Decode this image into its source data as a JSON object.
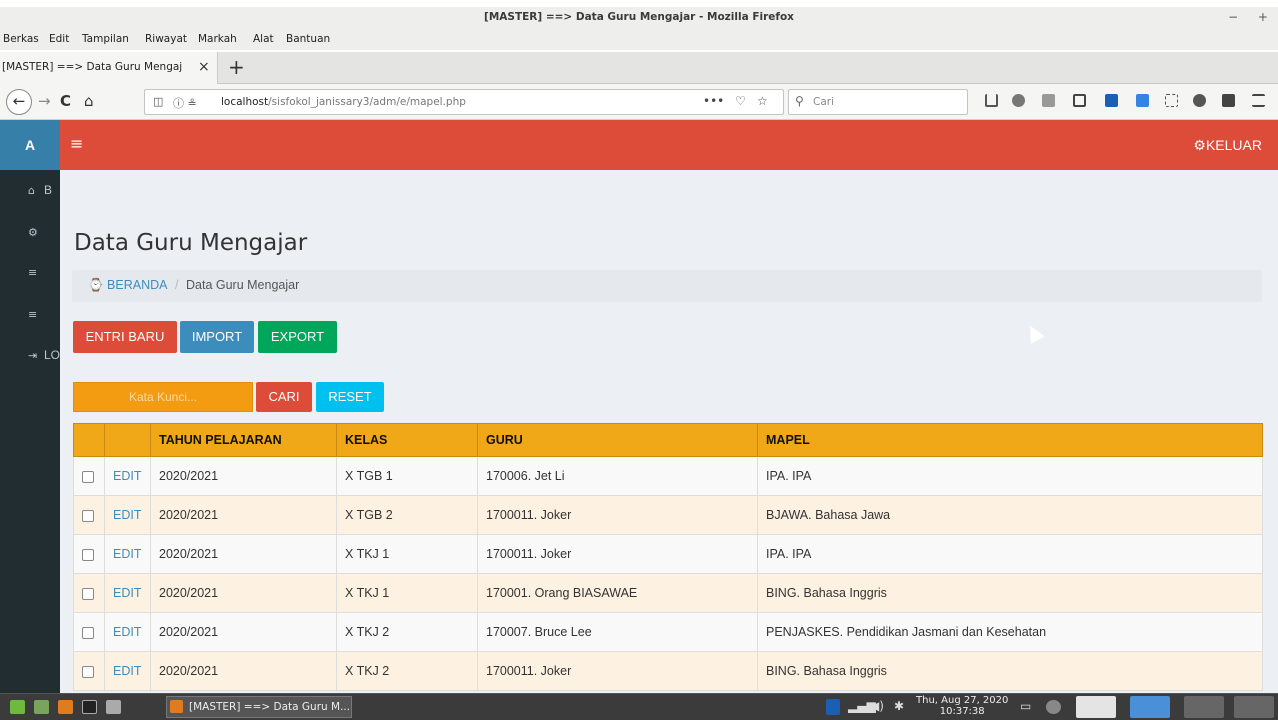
{
  "window": {
    "title": "[MASTER] ==> Data Guru Mengajar - Mozilla Firefox",
    "controls": "− +"
  },
  "menu": [
    "Berkas",
    "Edit",
    "Tampilan",
    "Riwayat",
    "Markah",
    "Alat",
    "Bantuan"
  ],
  "tab": {
    "label": "[MASTER] ==> Data Guru Mengaj",
    "close": "×",
    "new": "+"
  },
  "nav": {
    "url_host": "localhost",
    "url_path": "/sisfokol_janissary3/adm/e/mapel.php",
    "search_placeholder": "Cari",
    "more": "•••"
  },
  "app": {
    "logo": "A",
    "menu_toggle": "≡",
    "logout": "KELUAR",
    "sidebar": [
      {
        "icon": "home-icon",
        "label": "B"
      },
      {
        "icon": "gears-icon",
        "label": ""
      },
      {
        "icon": "database-icon",
        "label": ""
      },
      {
        "icon": "database-icon",
        "label": ""
      },
      {
        "icon": "signout-icon",
        "label": "LO"
      }
    ],
    "page_title": "Data Guru Mengajar",
    "breadcrumb": {
      "home": "BERANDA",
      "sep": "/",
      "current": "Data Guru Mengajar"
    },
    "buttons": {
      "entri": "ENTRI BARU",
      "import": "IMPORT",
      "export": "EXPORT",
      "search": "CARI",
      "reset": "RESET"
    },
    "search_placeholder": "Kata Kunci...",
    "colors": {
      "header": "#dd4b39",
      "sidebar": "#222d32",
      "table_head": "#f0a818",
      "danger": "#dd4b39",
      "primary": "#3c8dbc",
      "success": "#00a65a",
      "info": "#00c0ef",
      "warning": "#f39c12"
    },
    "table": {
      "headers": [
        "",
        "",
        "TAHUN PELAJARAN",
        "KELAS",
        "GURU",
        "MAPEL"
      ],
      "rows": [
        {
          "edit": "EDIT",
          "tahun": "2020/2021",
          "kelas": "X TGB 1",
          "guru": "170006. Jet Li",
          "mapel": "IPA. IPA"
        },
        {
          "edit": "EDIT",
          "tahun": "2020/2021",
          "kelas": "X TGB 2",
          "guru": "1700011. Joker",
          "mapel": "BJAWA. Bahasa Jawa"
        },
        {
          "edit": "EDIT",
          "tahun": "2020/2021",
          "kelas": "X TKJ 1",
          "guru": "1700011. Joker",
          "mapel": "IPA. IPA"
        },
        {
          "edit": "EDIT",
          "tahun": "2020/2021",
          "kelas": "X TKJ 1",
          "guru": "170001. Orang BIASAWAE",
          "mapel": "BING. Bahasa Inggris"
        },
        {
          "edit": "EDIT",
          "tahun": "2020/2021",
          "kelas": "X TKJ 2",
          "guru": "170007. Bruce Lee",
          "mapel": "PENJASKES. Pendidikan Jasmani dan Kesehatan"
        },
        {
          "edit": "EDIT",
          "tahun": "2020/2021",
          "kelas": "X TKJ 2",
          "guru": "1700011. Joker",
          "mapel": "BING. Bahasa Inggris"
        }
      ]
    }
  },
  "taskbar": {
    "window": "[MASTER] ==> Data Guru M...",
    "clock_date": "Thu, Aug 27, 2020",
    "clock_time": "10:37:38"
  }
}
